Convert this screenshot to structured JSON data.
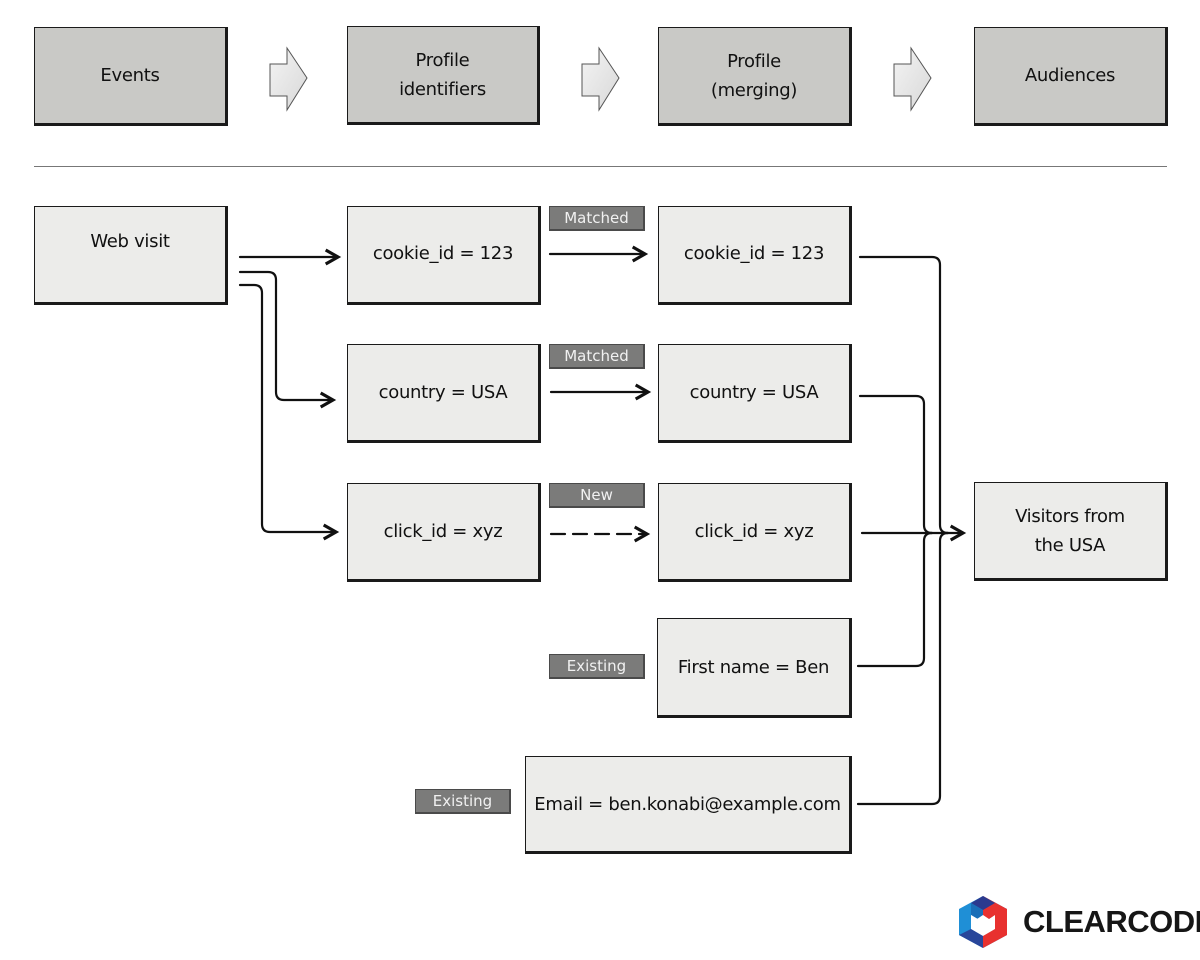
{
  "pipeline": {
    "stages": [
      {
        "label": "Events"
      },
      {
        "label": "Profile\nidentifiers"
      },
      {
        "label": "Profile\n(merging)"
      },
      {
        "label": "Audiences"
      }
    ]
  },
  "event": {
    "label": "Web visit"
  },
  "identifiers": [
    {
      "label": "cookie_id = 123",
      "status": "Matched",
      "link_style": "solid"
    },
    {
      "label": "country = USA",
      "status": "Matched",
      "link_style": "solid"
    },
    {
      "label": "click_id = xyz",
      "status": "New",
      "link_style": "dashed"
    }
  ],
  "profile_fields": [
    {
      "label": "cookie_id = 123"
    },
    {
      "label": "country = USA"
    },
    {
      "label": "click_id = xyz"
    },
    {
      "label": "First name = Ben",
      "status": "Existing"
    },
    {
      "label": "Email = ben.konabi@example.com",
      "status": "Existing"
    }
  ],
  "audience": {
    "label": "Visitors from\nthe USA"
  },
  "brand": {
    "name": "CLEARCODE",
    "colors": {
      "blue": "#1f8fd6",
      "navy": "#2b3a8f",
      "red": "#e8312f"
    }
  }
}
